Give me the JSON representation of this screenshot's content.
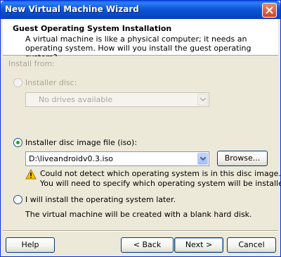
{
  "window": {
    "title": "New Virtual Machine Wizard"
  },
  "header": {
    "title": "Guest Operating System Installation",
    "description": "A virtual machine is like a physical computer; it needs an operating system. How will you install the guest operating system?"
  },
  "install_from_label": "Install from:",
  "options": {
    "installer_disc": {
      "label": "Installer disc:",
      "selected": false,
      "enabled": false,
      "combo_value": "No drives available"
    },
    "iso": {
      "label": "Installer disc image file (iso):",
      "selected": true,
      "enabled": true,
      "path": "D:\\liveandroidv0.3.iso",
      "browse_label": "Browse..."
    },
    "later": {
      "label": "I will install the operating system later.",
      "selected": false,
      "enabled": true,
      "note": "The virtual machine will be created with a blank hard disk."
    }
  },
  "warning": {
    "line1": "Could not detect which operating system is in this disc image.",
    "line2": "You will need to specify which operating system will be installed."
  },
  "buttons": {
    "help": "Help",
    "back": "< Back",
    "next": "Next >",
    "cancel": "Cancel"
  },
  "colors": {
    "titlebar": "#0b57d8",
    "dialog_bg": "#ece9d8",
    "warning": "#f5c400",
    "radio_dot": "#21a121"
  },
  "icons": {
    "close": "close-icon",
    "warning": "warning-icon",
    "dropdown": "chevron-down-icon"
  }
}
